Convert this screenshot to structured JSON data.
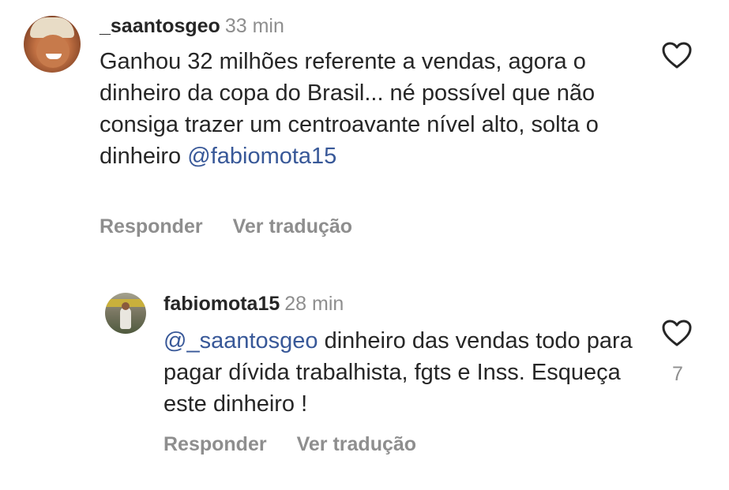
{
  "comments": [
    {
      "username": "_saantosgeo",
      "time": "33 min",
      "text": "Ganhou 32 milhões referente a vendas, agora o dinheiro da copa do Brasil... né possível que não consiga trazer um centroavante nível alto, solta o dinheiro ",
      "mention": "@fabiomota15",
      "reply_label": "Responder",
      "translate_label": "Ver tradução"
    },
    {
      "username": "fabiomota15",
      "time": "28 min",
      "mention": "@_saantosgeo",
      "text": " dinheiro das vendas todo para pagar dívida trabalhista, fgts e Inss. Esqueça este dinheiro !",
      "reply_label": "Responder",
      "translate_label": "Ver tradução",
      "like_count": "7"
    }
  ],
  "icons": {
    "like": "heart-outline-icon"
  },
  "colors": {
    "mention": "#385898",
    "muted": "#8e8e8e",
    "text": "#262626"
  }
}
